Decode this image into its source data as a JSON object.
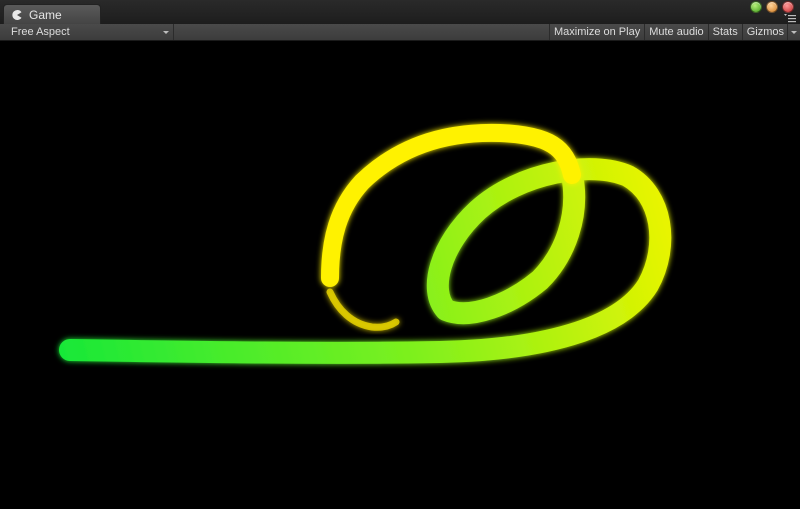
{
  "tab": {
    "label": "Game",
    "icon": "pacman-icon"
  },
  "window_controls": [
    "green-zoom-icon",
    "orange-minimize-icon",
    "red-close-icon",
    "panel-menu-icon"
  ],
  "toolbar": {
    "aspect_label": "Free Aspect",
    "maximize_label": "Maximize on Play",
    "mute_label": "Mute audio",
    "stats_label": "Stats",
    "gizmos_label": "Gizmos"
  },
  "colors": {
    "stroke_green": "#1eea2e",
    "stroke_yellow": "#fff000",
    "background": "#000000"
  }
}
